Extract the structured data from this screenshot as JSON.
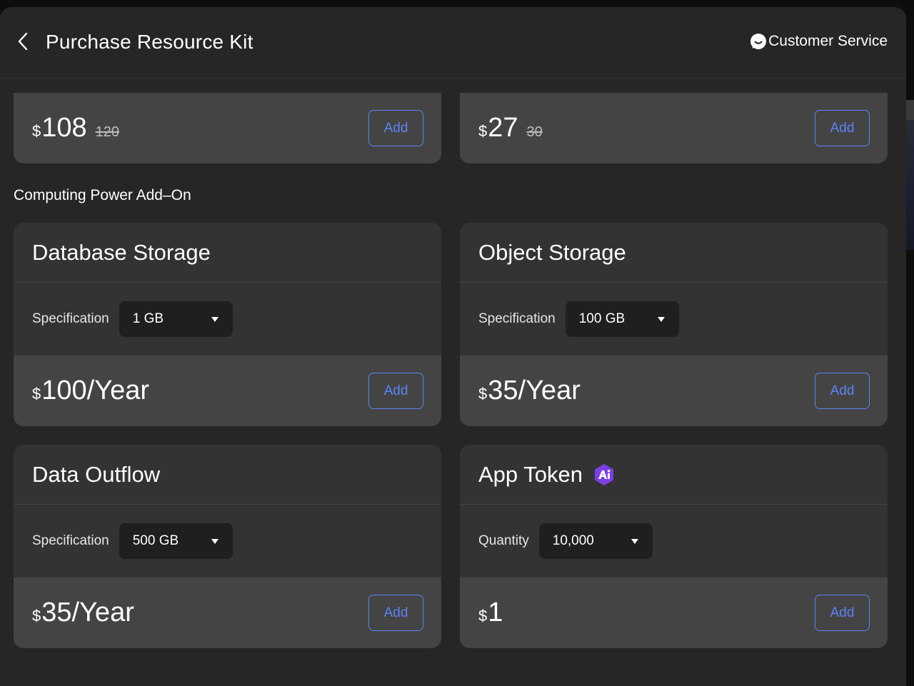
{
  "header": {
    "title": "Purchase Resource Kit",
    "customer_service": "Customer Service"
  },
  "top_cards": [
    {
      "currency": "$",
      "price": "108",
      "original_price": "120",
      "add_label": "Add"
    },
    {
      "currency": "$",
      "price": "27",
      "original_price": "30",
      "add_label": "Add"
    }
  ],
  "section": {
    "title": "Computing Power Add–On"
  },
  "addons": [
    {
      "name": "Database Storage",
      "field_label": "Specification",
      "selected": "1 GB",
      "currency": "$",
      "price": "100/Year",
      "add_label": "Add"
    },
    {
      "name": "Object Storage",
      "field_label": "Specification",
      "selected": "100 GB",
      "currency": "$",
      "price": "35/Year",
      "add_label": "Add"
    },
    {
      "name": "Data Outflow",
      "field_label": "Specification",
      "selected": "500 GB",
      "currency": "$",
      "price": "35/Year",
      "add_label": "Add"
    },
    {
      "name": "App Token",
      "field_label": "Quantity",
      "selected": "10,000",
      "currency": "$",
      "price": "1",
      "add_label": "Add",
      "badge_icon": "ai-badge-icon"
    }
  ],
  "colors": {
    "panel_bg": "#262626",
    "card_bg": "#333333",
    "card_footer_bg": "#444444",
    "select_bg": "#1f1f1f",
    "accent": "#5b84f5",
    "ai_badge": "#7b3fe4"
  },
  "icons": {
    "back": "chevron-left-icon",
    "customer_service": "chat-bubble-icon",
    "dropdown": "caret-down-icon",
    "ai": "ai-badge-icon"
  }
}
